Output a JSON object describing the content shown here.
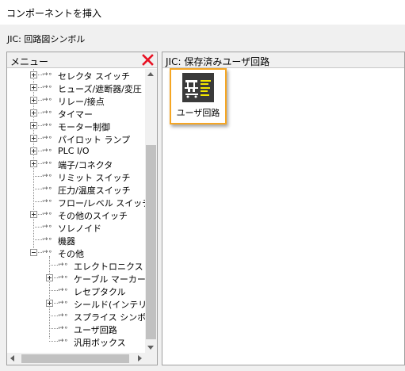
{
  "window": {
    "title": "コンポーネントを挿入"
  },
  "library": {
    "name": "JIC: 回路図シンボル"
  },
  "menu_panel": {
    "header": "メニュー",
    "tree": [
      {
        "label": "セレクタ スイッチ",
        "level": 0,
        "expander": "plus"
      },
      {
        "label": "ヒューズ/遮断器/変圧",
        "level": 0,
        "expander": "plus"
      },
      {
        "label": "リレー/接点",
        "level": 0,
        "expander": "plus"
      },
      {
        "label": "タイマー",
        "level": 0,
        "expander": "plus"
      },
      {
        "label": "モーター制御",
        "level": 0,
        "expander": "plus"
      },
      {
        "label": "パイロット ランプ",
        "level": 0,
        "expander": "plus"
      },
      {
        "label": "PLC I/O",
        "level": 0,
        "expander": "plus"
      },
      {
        "label": "端子/コネクタ",
        "level": 0,
        "expander": "plus"
      },
      {
        "label": "リミット スイッチ",
        "level": 0,
        "expander": "none"
      },
      {
        "label": "圧力/温度スイッチ",
        "level": 0,
        "expander": "none"
      },
      {
        "label": "フロー/レベル スイッチ",
        "level": 0,
        "expander": "none"
      },
      {
        "label": "その他のスイッチ",
        "level": 0,
        "expander": "plus"
      },
      {
        "label": "ソレノイド",
        "level": 0,
        "expander": "none"
      },
      {
        "label": "機器",
        "level": 0,
        "expander": "none"
      },
      {
        "label": "その他",
        "level": 0,
        "expander": "minus"
      },
      {
        "label": "エレクトロニクス",
        "level": 1,
        "expander": "none"
      },
      {
        "label": "ケーブル マーカー",
        "level": 1,
        "expander": "plus"
      },
      {
        "label": "レセプタクル",
        "level": 1,
        "expander": "none"
      },
      {
        "label": "シールド(インテリジ",
        "level": 1,
        "expander": "plus"
      },
      {
        "label": "スプライス シンボル",
        "level": 1,
        "expander": "none"
      },
      {
        "label": "ユーザ回路",
        "level": 1,
        "expander": "none"
      },
      {
        "label": "汎用ボックス",
        "level": 1,
        "expander": "none"
      }
    ]
  },
  "content_panel": {
    "header": "JIC: 保存済みユーザ回路",
    "items": [
      {
        "label": "ユーザ回路",
        "icon": "user-circuit-icon",
        "selected": true
      }
    ]
  },
  "colors": {
    "selection_border": "#f5a623",
    "close_icon": "#e81123",
    "icon_bg": "#3a3a3a",
    "icon_text": "#f2e600"
  }
}
